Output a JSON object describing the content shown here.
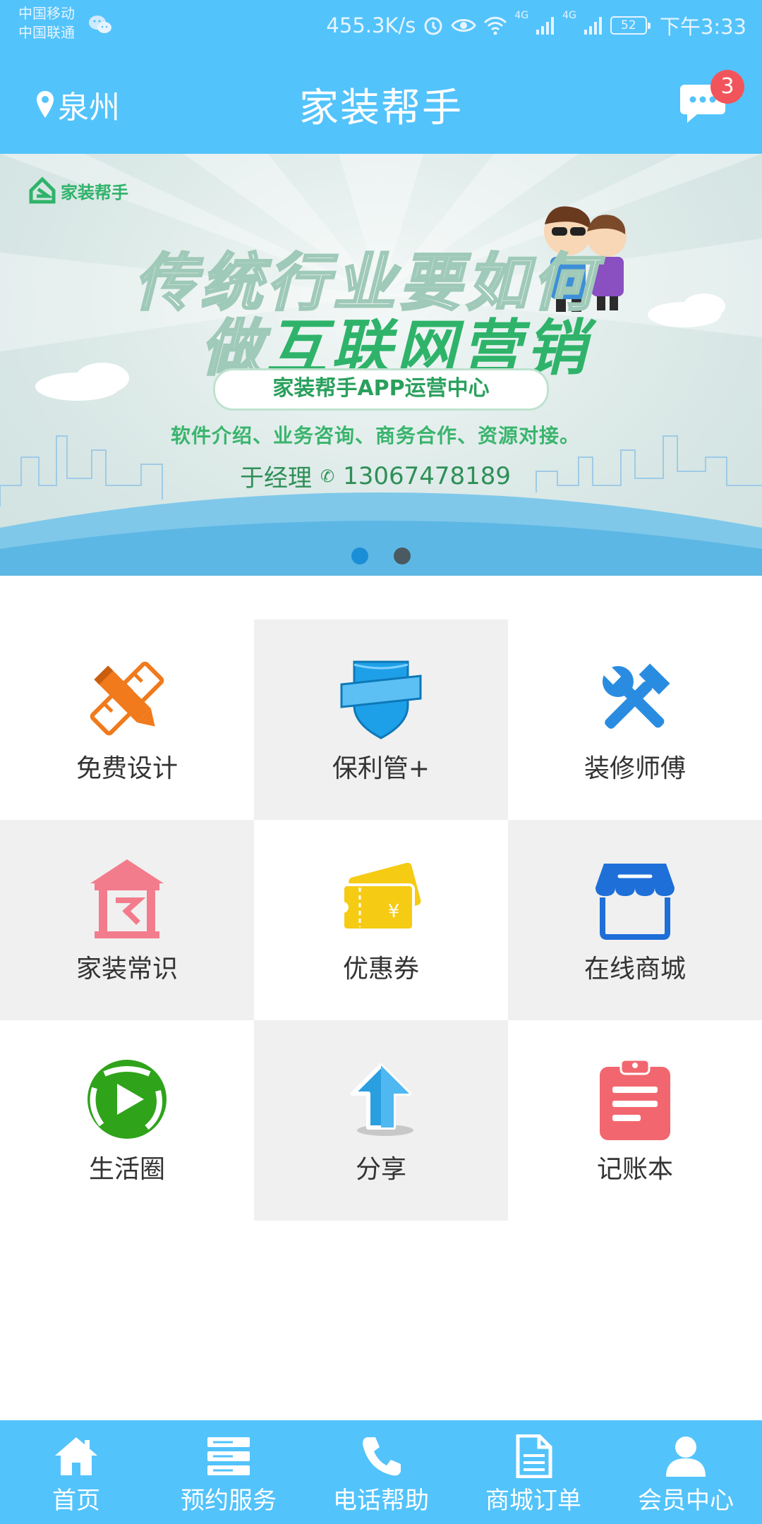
{
  "status_bar": {
    "carrier1": "中国移动",
    "carrier2": "中国联通",
    "speed": "455.3K/s",
    "network1": "4G",
    "network2": "4G",
    "battery": "52",
    "time": "下午3:33"
  },
  "header": {
    "city": "泉州",
    "title": "家装帮手",
    "message_badge": "3"
  },
  "banner": {
    "logo_text": "家装帮手",
    "headline_line1": "传统行业要如何",
    "headline_line2_prefix": "做",
    "headline_line2_highlight": "互联网营销",
    "pill_text": "家装帮手APP运营中心",
    "services": "软件介绍、业务咨询、商务合作、资源对接。",
    "contact_name": "于经理",
    "contact_phone": "13067478189",
    "dots": 2,
    "active_dot": 0
  },
  "grid": [
    {
      "label": "免费设计",
      "icon": "design-ruler-pencil-icon",
      "color": "#f07a1c"
    },
    {
      "label": "保利管+",
      "icon": "shield-banner-icon",
      "color": "#1ea0e8"
    },
    {
      "label": "装修师傅",
      "icon": "wrench-hammer-icon",
      "color": "#2a8ce0"
    },
    {
      "label": "家装常识",
      "icon": "house-knowledge-icon",
      "color": "#f37c8c"
    },
    {
      "label": "优惠券",
      "icon": "coupon-ticket-icon",
      "color": "#f5cb14"
    },
    {
      "label": "在线商城",
      "icon": "storefront-icon",
      "color": "#1e6fd8"
    },
    {
      "label": "生活圈",
      "icon": "play-circle-icon",
      "color": "#2fa31a"
    },
    {
      "label": "分享",
      "icon": "share-arrow-icon",
      "color": "#2a9fe0"
    },
    {
      "label": "记账本",
      "icon": "clipboard-notes-icon",
      "color": "#f2676f"
    }
  ],
  "bottom_nav": [
    {
      "label": "首页",
      "icon": "home-icon"
    },
    {
      "label": "预约服务",
      "icon": "server-list-icon"
    },
    {
      "label": "电话帮助",
      "icon": "phone-icon"
    },
    {
      "label": "商城订单",
      "icon": "document-icon"
    },
    {
      "label": "会员中心",
      "icon": "user-icon"
    }
  ],
  "colors": {
    "brand": "#53c3fb",
    "badge": "#f2545b",
    "banner_green": "#2fb36a"
  }
}
